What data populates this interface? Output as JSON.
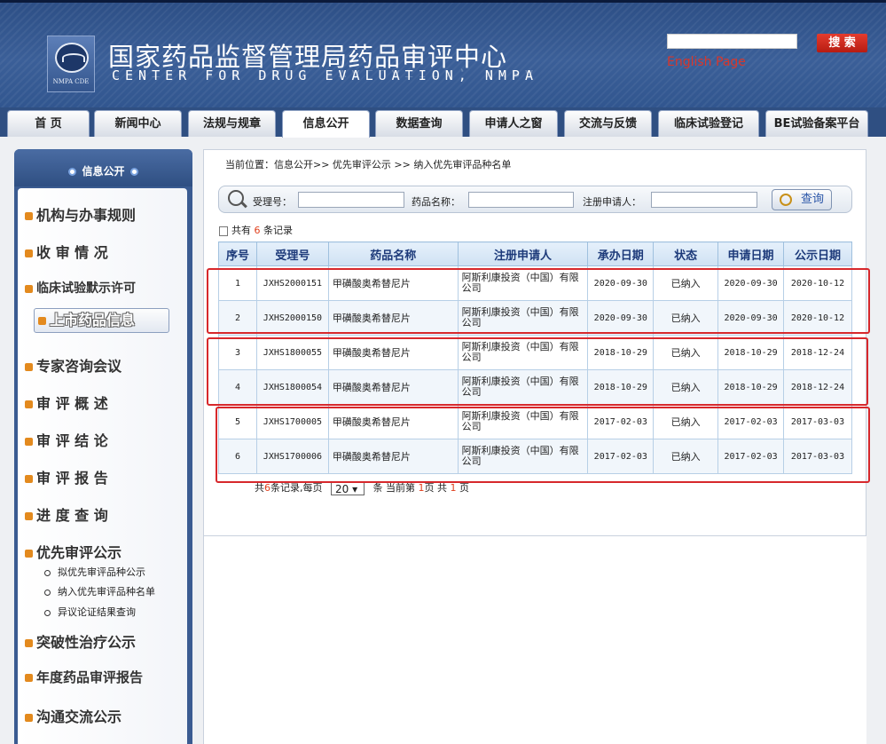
{
  "header": {
    "title_cn": "国家药品监督管理局药品审评中心",
    "title_en": "CENTER FOR DRUG EVALUATION, NMPA",
    "logo_text": "NMPA CDE",
    "search_button": "搜 索",
    "english_link": "English Page"
  },
  "nav": [
    "首 页",
    "新闻中心",
    "法规与规章",
    "信息公开",
    "数据查询",
    "申请人之窗",
    "交流与反馈",
    "临床试验登记",
    "BE试验备案平台"
  ],
  "sidebar": {
    "heading": "信息公开",
    "items": [
      "机构与办事规则",
      "收 审 情 况",
      "临床试验默示许可",
      "上市药品信息",
      "专家咨询会议",
      "审 评 概 述",
      "审 评 结 论",
      "审 评 报 告",
      "进 度 查 询",
      "优先审评公示",
      "突破性治疗公示",
      "年度药品审评报告",
      "沟通交流公示"
    ],
    "sub_items": [
      "拟优先审评品种公示",
      "纳入优先审评品种名单",
      "异议论证结果查询"
    ]
  },
  "breadcrumb": "当前位置：信息公开>> 优先审评公示 >> 纳入优先审评品种名单",
  "search": {
    "accept_label": "受理号：",
    "drug_label": "药品名称：",
    "applicant_label": "注册申请人：",
    "button": "查询"
  },
  "summary": {
    "prefix": "共有",
    "count": "6",
    "suffix": "条记录"
  },
  "table": {
    "headers": [
      "序号",
      "受理号",
      "药品名称",
      "注册申请人",
      "承办日期",
      "状态",
      "申请日期",
      "公示日期"
    ],
    "rows": [
      [
        "1",
        "JXHS2000151",
        "甲磺酸奥希替尼片",
        "阿斯利康投资（中国）有限公司",
        "2020-09-30",
        "已纳入",
        "2020-09-30",
        "2020-10-12"
      ],
      [
        "2",
        "JXHS2000150",
        "甲磺酸奥希替尼片",
        "阿斯利康投资（中国）有限公司",
        "2020-09-30",
        "已纳入",
        "2020-09-30",
        "2020-10-12"
      ],
      [
        "3",
        "JXHS1800055",
        "甲磺酸奥希替尼片",
        "阿斯利康投资（中国）有限公司",
        "2018-10-29",
        "已纳入",
        "2018-10-29",
        "2018-12-24"
      ],
      [
        "4",
        "JXHS1800054",
        "甲磺酸奥希替尼片",
        "阿斯利康投资（中国）有限公司",
        "2018-10-29",
        "已纳入",
        "2018-10-29",
        "2018-12-24"
      ],
      [
        "5",
        "JXHS1700005",
        "甲磺酸奥希替尼片",
        "阿斯利康投资（中国）有限公司",
        "2017-02-03",
        "已纳入",
        "2017-02-03",
        "2017-03-03"
      ],
      [
        "6",
        "JXHS1700006",
        "甲磺酸奥希替尼片",
        "阿斯利康投资（中国）有限公司",
        "2017-02-03",
        "已纳入",
        "2017-02-03",
        "2017-03-03"
      ]
    ]
  },
  "pager": {
    "total_prefix": "共",
    "total": "6",
    "total_suffix": "条记录,每页",
    "per_page": "20 ▾",
    "page_prefix": "条 当前第",
    "current": "1",
    "page_mid": "页 共",
    "pages": "1",
    "page_suffix": "页"
  },
  "colors": {
    "highlight_box": "#d7282c",
    "header_blue": "#2f4f82",
    "accent_orange": "#e0401d"
  }
}
